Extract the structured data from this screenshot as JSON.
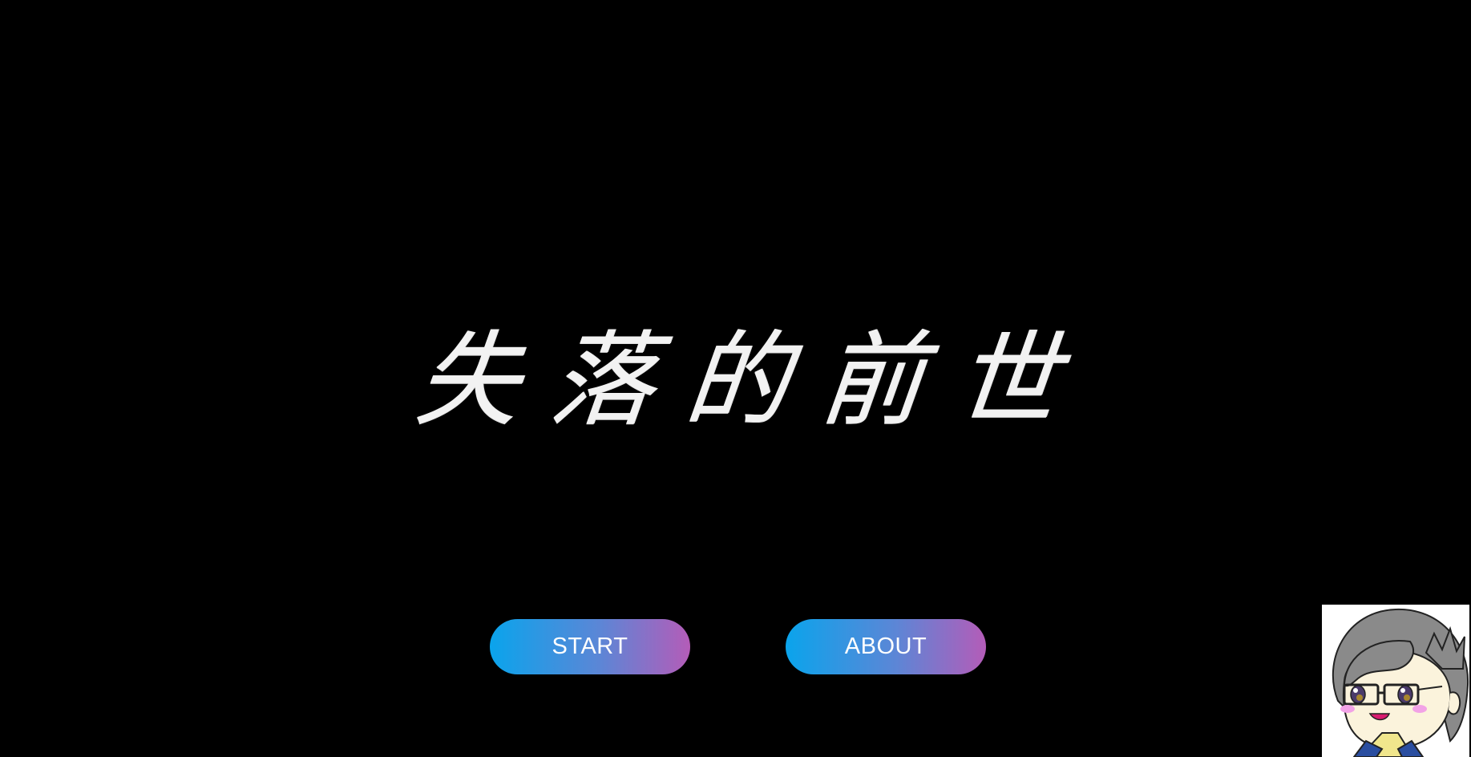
{
  "title": {
    "chars": [
      "失",
      "落",
      "的",
      "前",
      "世"
    ]
  },
  "menu": {
    "start_label": "START",
    "about_label": "ABOUT"
  },
  "colors": {
    "background": "#000000",
    "button_gradient_start": "#0aa4ec",
    "button_gradient_end": "#b45cb8",
    "title_text": "#f2f2f2"
  },
  "avatar": {
    "icon": "character-portrait-icon"
  }
}
